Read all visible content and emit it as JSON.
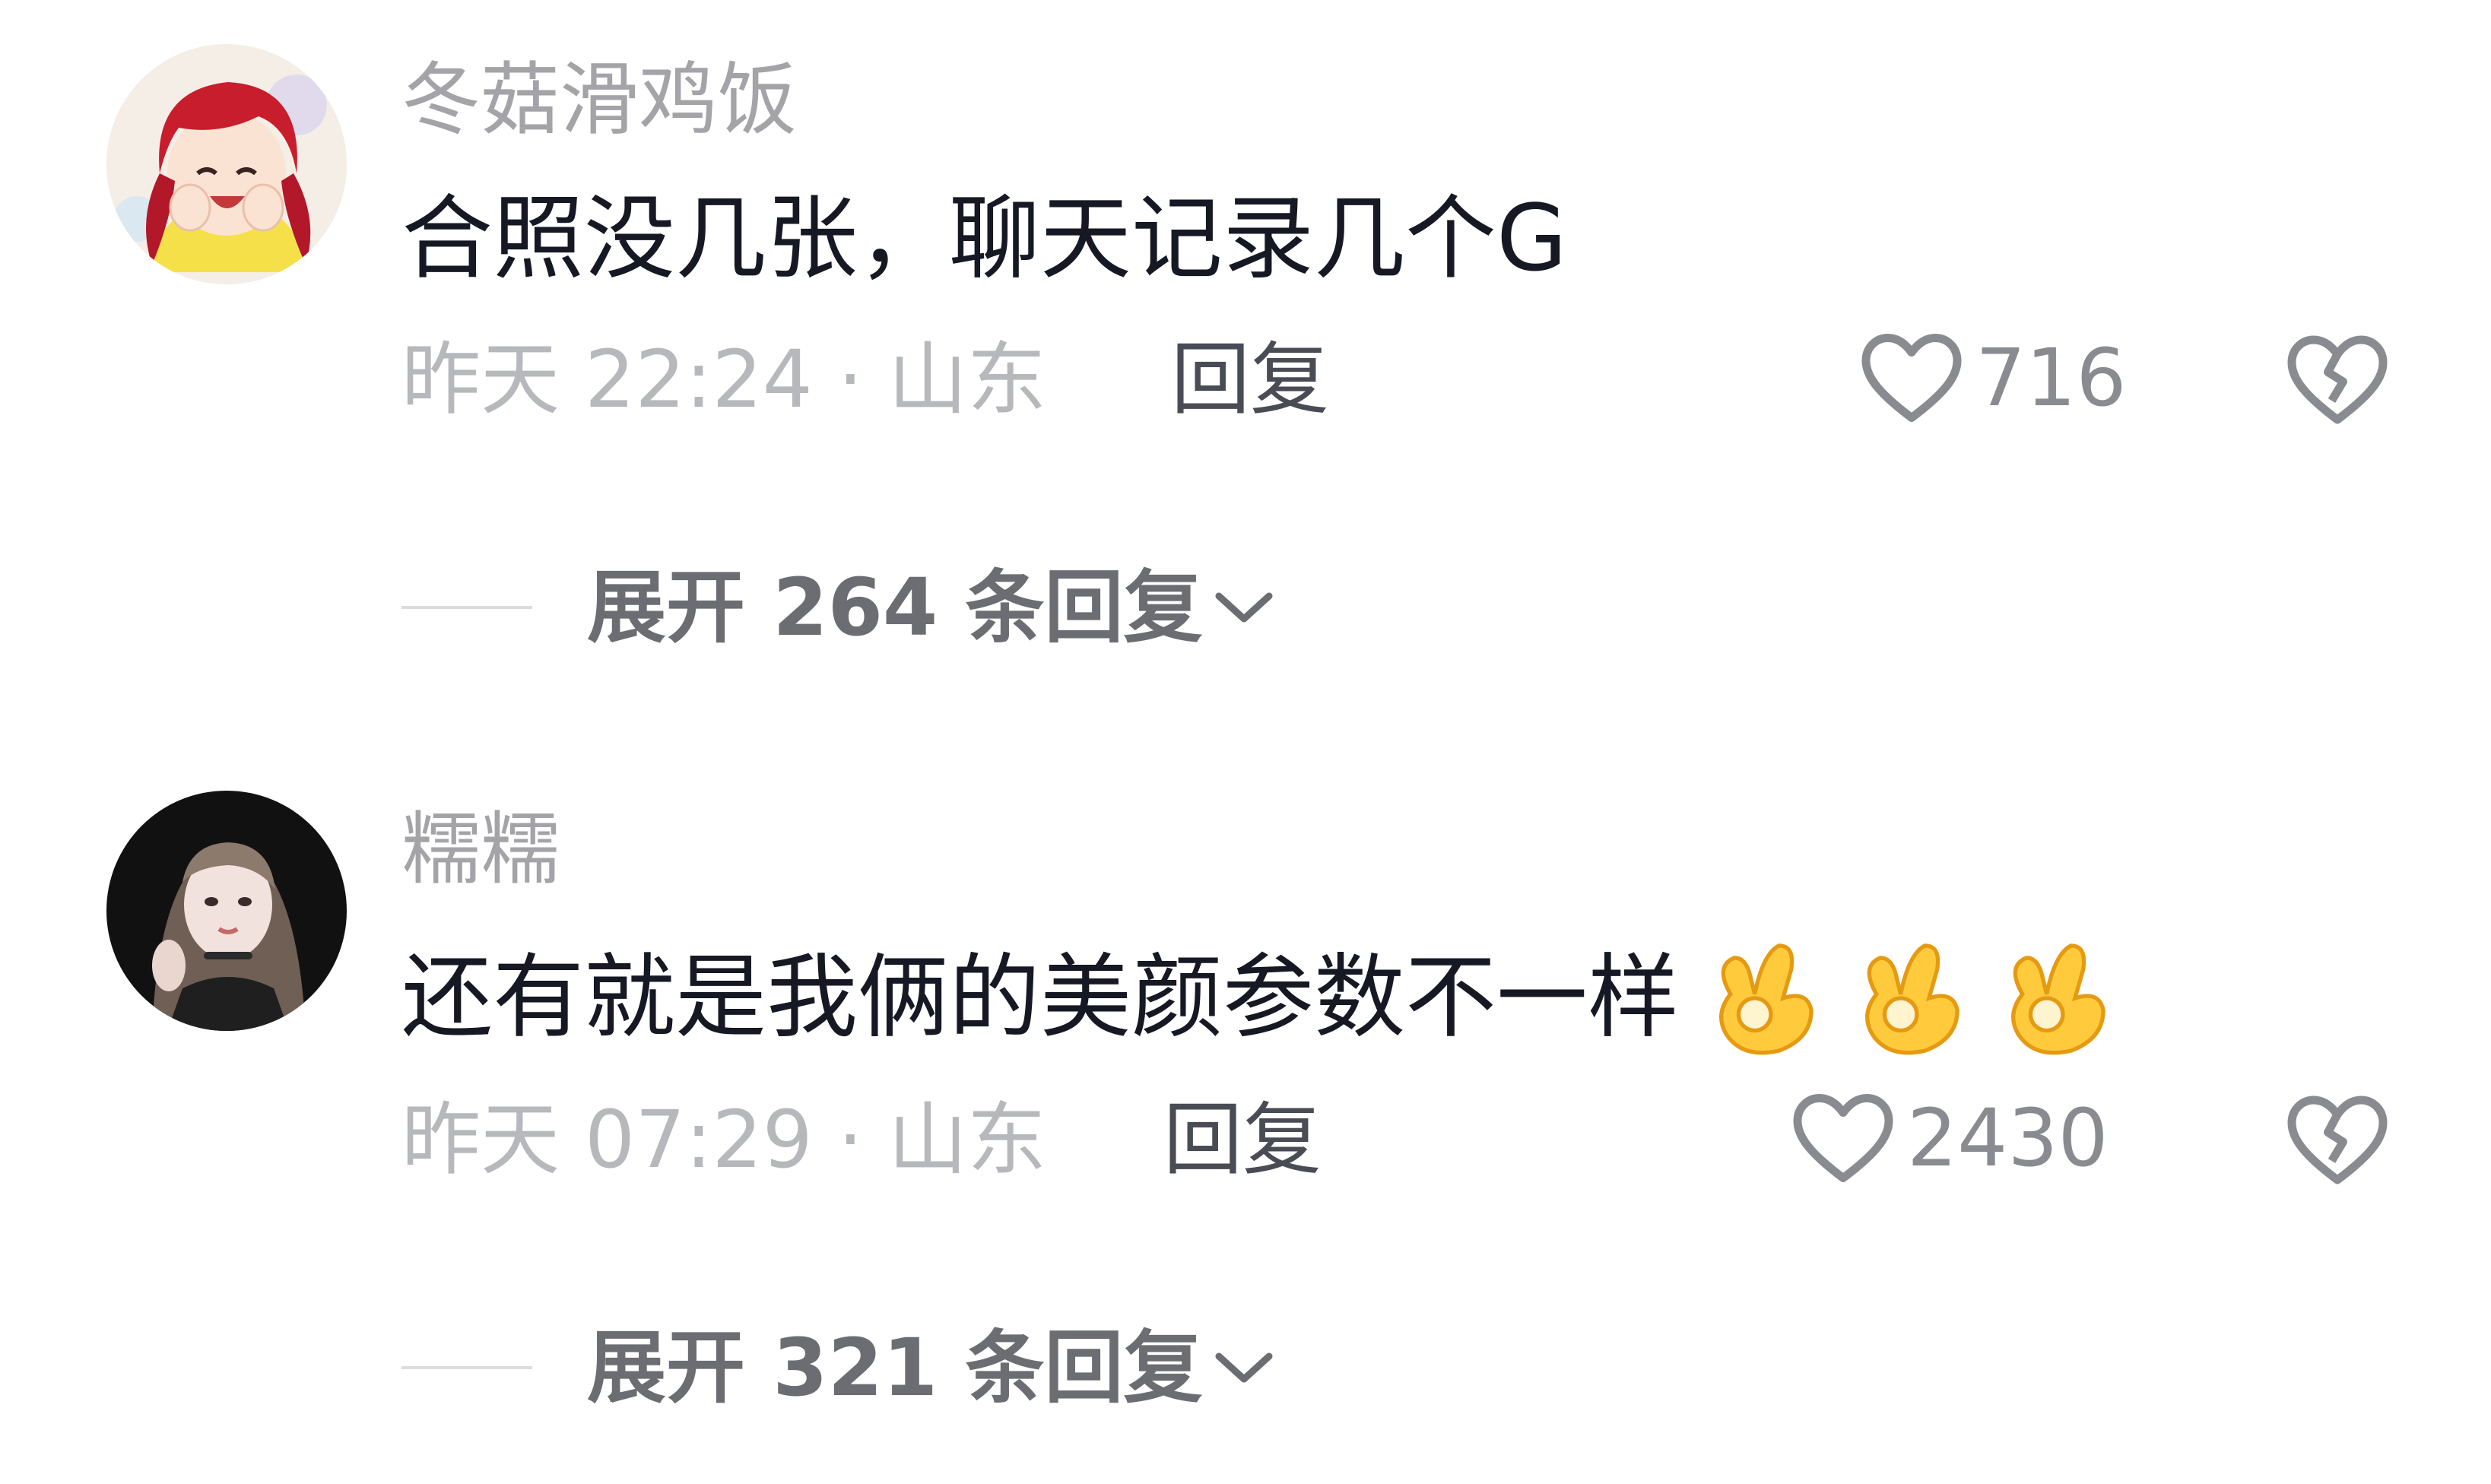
{
  "comments": [
    {
      "username": "冬菇滑鸡饭",
      "text": "合照没几张，聊天记录几个G",
      "meta": "昨天 22:24 · 山东",
      "reply_label": "回复",
      "likes": "716",
      "expand": "展开 264 条回复",
      "icons": {
        "avatar": "avatar-anime-girl",
        "like": "heart-outline-icon",
        "dislike": "broken-heart-icon",
        "expand": "chevron-down-icon"
      }
    },
    {
      "username": "糯糯",
      "text": "还有就是我俩的美颜参数不一样",
      "emojis": [
        "ok-hand",
        "ok-hand",
        "ok-hand"
      ],
      "meta": "昨天 07:29 · 山东",
      "reply_label": "回复",
      "likes": "2430",
      "expand": "展开 321 条回复",
      "icons": {
        "avatar": "avatar-photo-girl",
        "like": "heart-outline-icon",
        "dislike": "broken-heart-icon",
        "expand": "chevron-down-icon"
      }
    }
  ],
  "colors": {
    "username": "#a3a3a8",
    "text": "#161823",
    "meta": "#b7b8bc",
    "reply": "#4a4c55",
    "expand": "#6c6d73"
  }
}
